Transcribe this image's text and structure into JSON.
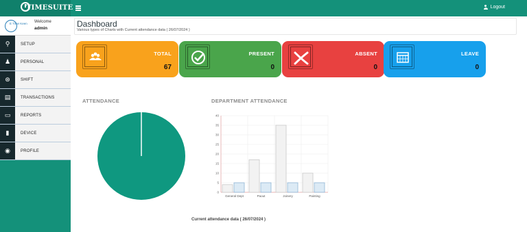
{
  "header": {
    "brand": "TIMESUITE",
    "logout_label": "Logout"
  },
  "user": {
    "welcome": "Welcome",
    "name": "admin",
    "logo_text": "E Time Keen"
  },
  "nav": [
    {
      "label": "SETUP",
      "icon": "key-icon"
    },
    {
      "label": "PERSONAL",
      "icon": "user-icon"
    },
    {
      "label": "SHIFT",
      "icon": "sitemap-icon"
    },
    {
      "label": "TRANSACTIONS",
      "icon": "document-icon"
    },
    {
      "label": "REPORTS",
      "icon": "file-icon"
    },
    {
      "label": "DEVICE",
      "icon": "device-icon"
    },
    {
      "label": "PROFILE",
      "icon": "profile-icon"
    }
  ],
  "page": {
    "title": "Dashboard",
    "subtitle": "Various types of Charts with Current attendance data ( 26/07/2024 )"
  },
  "cards": [
    {
      "title": "TOTAL",
      "value": "67",
      "color": "#f9a21c",
      "icon": "users-icon"
    },
    {
      "title": "PRESENT",
      "value": "0",
      "color": "#4aa54b",
      "icon": "check-icon"
    },
    {
      "title": "ABSENT",
      "value": "0",
      "color": "#e84140",
      "icon": "x-icon"
    },
    {
      "title": "LEAVE",
      "value": "0",
      "color": "#17a0ec",
      "icon": "calendar-icon"
    }
  ],
  "attendance": {
    "title": "ATTENDANCE",
    "pie_color": "#0f9880"
  },
  "department": {
    "title": "DEPARTMENT ATTENDANCE"
  },
  "chart_data": {
    "type": "bar",
    "categories": [
      "General Dept",
      "Paout",
      "Joinery",
      "Painting"
    ],
    "series": [
      {
        "values": [
          4,
          17,
          35,
          10
        ],
        "color": "#f2f2f2"
      },
      {
        "values": [
          5,
          5,
          5,
          5
        ],
        "color": "#dceaf5"
      }
    ],
    "y_ticks": [
      "0",
      "5",
      "10",
      "15",
      "20",
      "25",
      "30",
      "35",
      "40"
    ],
    "ylim": [
      0,
      40
    ],
    "grid": true
  },
  "footer": {
    "caption": "Current attendance data ( 26/07/2024 )"
  }
}
